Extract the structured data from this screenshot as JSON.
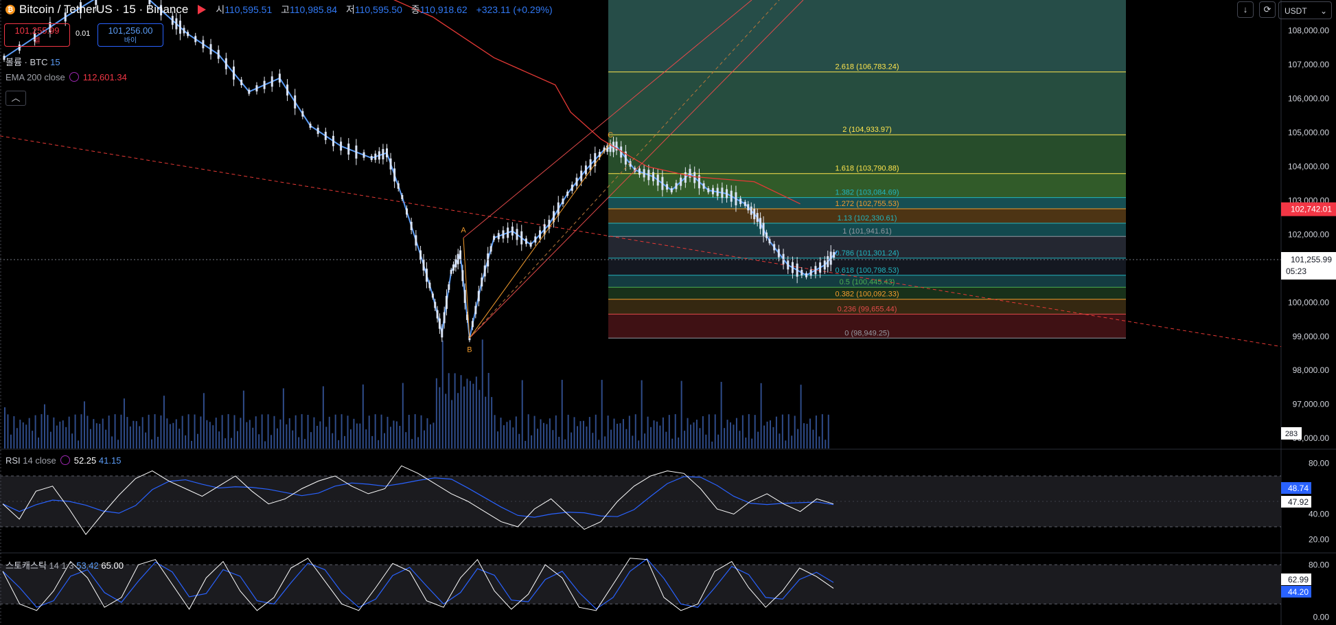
{
  "header": {
    "symbol": "Bitcoin / TetherUS · 15 · Binance",
    "open_label": "시",
    "open": "110,595.51",
    "high_label": "고",
    "high": "110,985.84",
    "low_label": "저",
    "low": "110,595.50",
    "close_label": "종",
    "close": "110,918.62",
    "change": "+323.11 (+0.29%)"
  },
  "trade": {
    "sell_price": "101,255.99",
    "sell_label": "셀",
    "buy_price": "101,256.00",
    "buy_label": "바이",
    "quantity": "0.01"
  },
  "indicators": {
    "volume_label": "볼륨 · BTC",
    "volume_value": "15",
    "ema_label": "EMA 200 close",
    "ema_value": "112,601.34",
    "rsi_label": "RSI",
    "rsi_params": "14 close",
    "rsi_value": "52.25",
    "rsi_ma": "41.15",
    "stoch_label": "스토캐스틱",
    "stoch_params": "14 1 3",
    "stoch_k": "53.42",
    "stoch_d": "65.00"
  },
  "toolbar": {
    "currency": "USDT",
    "download_icon": "arrow-down-icon",
    "screenshot_icon": "camera-icon",
    "collapse_icon": "chevron-up-icon"
  },
  "colors": {
    "background": "#000000",
    "candle": "#5b9cf6",
    "ema": "#e53935",
    "fib_golden": "#ffe64d",
    "fib_teal": "#22b5bf",
    "fib_orange": "#f39c2d",
    "fib_red": "#e34a4a",
    "price_label_red": "#f23645",
    "rsi_line": "#ffffff",
    "rsi_ma": "#2962ff"
  },
  "chart_data": {
    "type": "candlestick",
    "timeframe": "15",
    "price_axis": {
      "ticks": [
        "108,000.00",
        "107,000.00",
        "106,000.00",
        "105,000.00",
        "104,000.00",
        "103,000.00",
        "102,000.00",
        "101,000.00",
        "100,000.00",
        "99,000.00",
        "98,000.00",
        "97,000.00",
        "96,000.00"
      ],
      "ylim": [
        95700,
        108900
      ]
    },
    "price_series": [
      {
        "x": 0,
        "y": 107200
      },
      {
        "x": 20,
        "y": 108400
      },
      {
        "x": 40,
        "y": 109500
      },
      {
        "x": 55,
        "y": 108300
      },
      {
        "x": 60,
        "y": 107900
      },
      {
        "x": 70,
        "y": 107300
      },
      {
        "x": 80,
        "y": 106200
      },
      {
        "x": 90,
        "y": 106600
      },
      {
        "x": 100,
        "y": 105200
      },
      {
        "x": 110,
        "y": 104600
      },
      {
        "x": 120,
        "y": 104250
      },
      {
        "x": 125,
        "y": 104400
      },
      {
        "x": 130,
        "y": 103100
      },
      {
        "x": 136,
        "y": 101400
      },
      {
        "x": 140,
        "y": 100200
      },
      {
        "x": 143,
        "y": 99100
      },
      {
        "x": 146,
        "y": 100900
      },
      {
        "x": 149,
        "y": 101400
      },
      {
        "x": 152,
        "y": 98949
      },
      {
        "x": 156,
        "y": 100600
      },
      {
        "x": 160,
        "y": 101900
      },
      {
        "x": 166,
        "y": 102100
      },
      {
        "x": 172,
        "y": 101700
      },
      {
        "x": 178,
        "y": 102300
      },
      {
        "x": 184,
        "y": 103200
      },
      {
        "x": 190,
        "y": 103900
      },
      {
        "x": 196,
        "y": 104500
      },
      {
        "x": 200,
        "y": 104600
      },
      {
        "x": 206,
        "y": 103900
      },
      {
        "x": 212,
        "y": 103700
      },
      {
        "x": 218,
        "y": 103300
      },
      {
        "x": 224,
        "y": 103800
      },
      {
        "x": 230,
        "y": 103300
      },
      {
        "x": 236,
        "y": 103200
      },
      {
        "x": 242,
        "y": 102900
      },
      {
        "x": 246,
        "y": 102500
      },
      {
        "x": 250,
        "y": 101800
      },
      {
        "x": 256,
        "y": 101100
      },
      {
        "x": 262,
        "y": 100800
      },
      {
        "x": 268,
        "y": 101100
      },
      {
        "x": 272,
        "y": 101500
      }
    ],
    "ema200": [
      {
        "x": 105,
        "y": 109400
      },
      {
        "x": 120,
        "y": 109200
      },
      {
        "x": 140,
        "y": 108400
      },
      {
        "x": 160,
        "y": 107200
      },
      {
        "x": 180,
        "y": 106400
      },
      {
        "x": 185,
        "y": 105600
      },
      {
        "x": 195,
        "y": 104800
      },
      {
        "x": 210,
        "y": 104000
      },
      {
        "x": 225,
        "y": 103700
      },
      {
        "x": 245,
        "y": 103550
      },
      {
        "x": 260,
        "y": 102900
      }
    ],
    "trendline": {
      "from": {
        "x": 0,
        "y": 104900
      },
      "to": {
        "x": 400,
        "y": 98700
      }
    },
    "current_price": "101,255.99",
    "countdown": "05:23",
    "price_tag_red": "102,742.01",
    "volume_last": "283",
    "abc_points": [
      {
        "label": "A",
        "x": 150,
        "y": 101900
      },
      {
        "label": "B",
        "x": 152,
        "y": 98949
      },
      {
        "label": "C",
        "x": 198,
        "y": 104700
      }
    ],
    "fib_levels": [
      {
        "ratio": "2.618",
        "price": 106783.24,
        "label": "2.618 (106,783.24)",
        "color": "#ffe64d"
      },
      {
        "ratio": "2",
        "price": 104933.97,
        "label": "2 (104,933.97)",
        "color": "#ffe64d"
      },
      {
        "ratio": "1.618",
        "price": 103790.88,
        "label": "1.618 (103,790.88)",
        "color": "#ffe64d"
      },
      {
        "ratio": "1.382",
        "price": 103084.69,
        "label": "1.382 (103,084.69)",
        "color": "#22b5bf"
      },
      {
        "ratio": "1.272",
        "price": 102755.53,
        "label": "1.272 (102,755.53)",
        "color": "#f39c2d"
      },
      {
        "ratio": "1.13",
        "price": 102330.61,
        "label": "1.13 (102,330.61)",
        "color": "#22b5bf"
      },
      {
        "ratio": "1",
        "price": 101941.61,
        "label": "1 (101,941.61)",
        "color": "#9598a1"
      },
      {
        "ratio": "0.786",
        "price": 101301.24,
        "label": "0.786 (101,301.24)",
        "color": "#22b5bf"
      },
      {
        "ratio": "0.618",
        "price": 100798.53,
        "label": "0.618 (100,798.53)",
        "color": "#22b5bf"
      },
      {
        "ratio": "0.5",
        "price": 100445.43,
        "label": "0.5 (100,445.43)",
        "color": "#4caf50"
      },
      {
        "ratio": "0.382",
        "price": 100092.33,
        "label": "0.382 (100,092.33)",
        "color": "#f39c2d"
      },
      {
        "ratio": "0.236",
        "price": 99655.44,
        "label": "0.236 (99,655.44)",
        "color": "#e34a4a"
      },
      {
        "ratio": "0",
        "price": 98949.25,
        "label": "0 (98,949.25)",
        "color": "#9598a1"
      }
    ],
    "rsi": {
      "ticks": [
        "80.00",
        "40.00",
        "20.00"
      ],
      "ylim": [
        10,
        90
      ],
      "value": "48.74",
      "ma": "47.92",
      "bands": [
        70,
        30
      ],
      "series": [
        48,
        36,
        58,
        62,
        44,
        24,
        40,
        55,
        68,
        74,
        66,
        60,
        54,
        62,
        70,
        58,
        48,
        52,
        60,
        66,
        70,
        62,
        56,
        60,
        78,
        72,
        64,
        56,
        50,
        42,
        34,
        30,
        44,
        52,
        40,
        28,
        34,
        50,
        62,
        70,
        74,
        72,
        60,
        44,
        40,
        50,
        56,
        48,
        42,
        52,
        48
      ]
    },
    "stochastic": {
      "ticks": [
        "80.00",
        "0.00"
      ],
      "ylim": [
        -10,
        95
      ],
      "k": "62.99",
      "d": "44.20",
      "bands": [
        80,
        20
      ],
      "series": [
        70,
        20,
        10,
        40,
        85,
        60,
        15,
        30,
        80,
        88,
        50,
        12,
        60,
        85,
        40,
        10,
        30,
        75,
        90,
        55,
        20,
        10,
        45,
        82,
        70,
        25,
        15,
        60,
        88,
        40,
        12,
        35,
        80,
        60,
        15,
        10,
        50,
        90,
        88,
        30,
        10,
        20,
        70,
        85,
        45,
        15,
        40,
        75,
        62,
        44
      ]
    }
  }
}
